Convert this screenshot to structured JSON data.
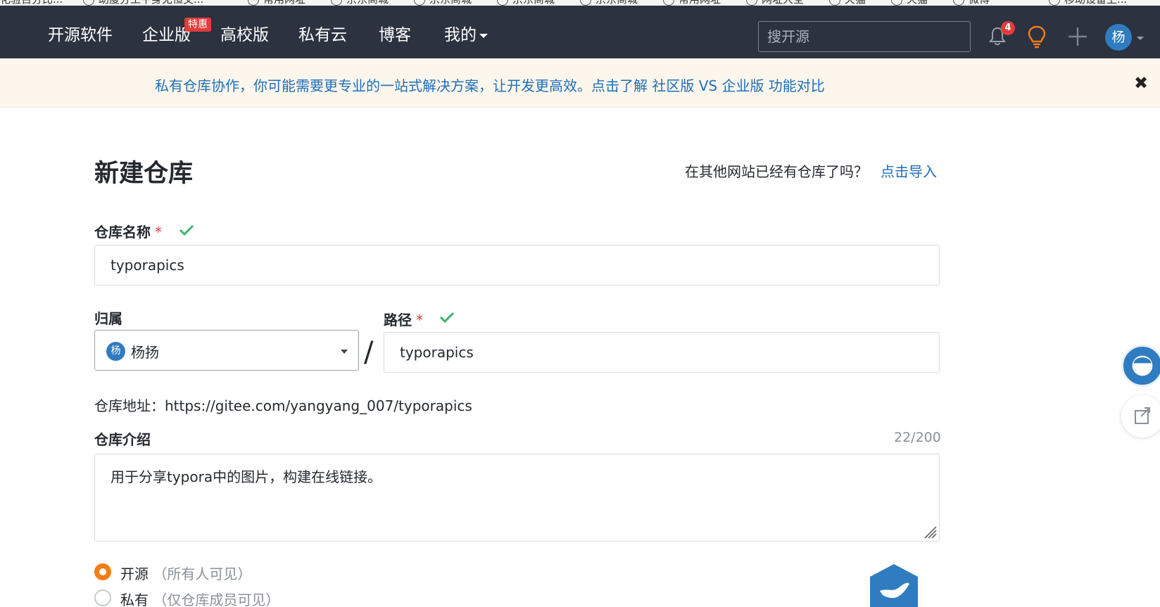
{
  "bookmarks": [
    "化验百分比...",
    "助度分工平身无恒交...",
    "常用网址",
    "京东商城",
    "京东商城",
    "京东商城",
    "京东商城",
    "常用网址",
    "网址大全",
    "天猫",
    "天猫",
    "微博",
    "移动设备上..."
  ],
  "nav": {
    "items": [
      "开源软件",
      "企业版",
      "高校版",
      "私有云",
      "博客",
      "我的"
    ],
    "hot_badge": "特惠",
    "search_placeholder": "搜开源",
    "notification_count": "4",
    "user_avatar": "杨"
  },
  "notice": {
    "text": "私有仓库协作，你可能需要更专业的一站式解决方案，让开发更高效。点击了解 社区版 VS 企业版 功能对比",
    "close": "✖"
  },
  "page": {
    "title": "新建仓库",
    "import_question": "在其他网站已经有仓库了吗？",
    "import_link": "点击导入"
  },
  "form": {
    "repo_name_label": "仓库名称",
    "required_mark": "*",
    "repo_name_value": "typorapics",
    "owner_label": "归属",
    "owner_avatar": "杨",
    "owner_name": "杨扬",
    "slash": "/",
    "path_label": "路径",
    "path_value": "typorapics",
    "repo_url": "仓库地址：https://gitee.com/yangyang_007/typorapics",
    "intro_label": "仓库介绍",
    "intro_counter": "22/200",
    "intro_value": "用于分享typora中的图片，构建在线链接。",
    "visibility": [
      {
        "label": "开源",
        "hint": "（所有人可见）",
        "selected": true
      },
      {
        "label": "私有",
        "hint": "（仅仓库成员可见）",
        "selected": false
      }
    ]
  },
  "colors": {
    "navbar": "#2c3240",
    "link": "#1e6fb8",
    "accent_orange": "#f57c14",
    "required_red": "#e23c3c",
    "check_green": "#3cb371"
  }
}
